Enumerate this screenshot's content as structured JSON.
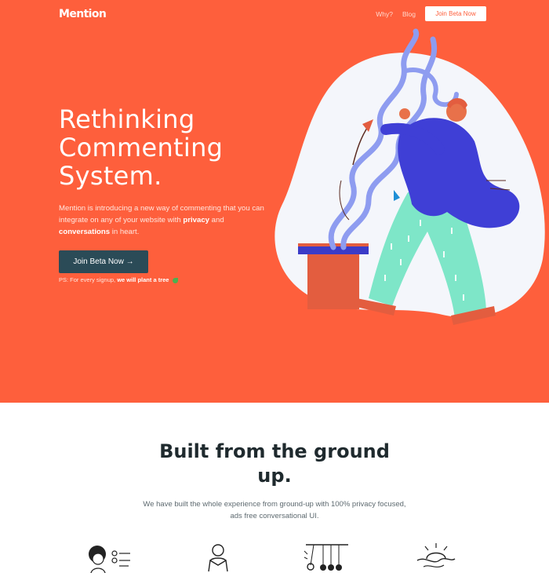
{
  "header": {
    "logo": "Mention",
    "nav": {
      "why": "Why?",
      "blog": "Blog",
      "cta": "Join Beta Now"
    }
  },
  "hero": {
    "title_lines": [
      "Rethinking",
      "Commenting",
      "System."
    ],
    "desc_part1": "Mention is introducing a new way of commenting that you can integrate on any of your website with ",
    "desc_privacy": "privacy",
    "desc_and": " and ",
    "desc_conversations": "conversations",
    "desc_end": " in heart.",
    "cta": "Join Beta Now →",
    "ps_prefix": "PS: For every signup, ",
    "ps_bold": "we will plant a tree"
  },
  "section": {
    "title_line1": "Built from the ground",
    "title_line2": "up.",
    "desc": "We have built the whole experience from ground-up with 100% privacy focused, ads free conversational UI."
  },
  "colors": {
    "brand": "#fe5f3c",
    "cta_dark": "#2b4b57",
    "illustration_blue": "#8e9cf0",
    "coat": "#3f3fd6",
    "pants": "#7ee6c8"
  }
}
